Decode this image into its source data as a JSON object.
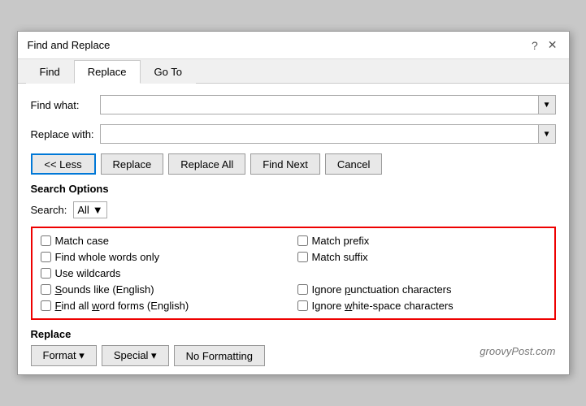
{
  "dialog": {
    "title": "Find and Replace",
    "help_icon": "?",
    "close_icon": "✕"
  },
  "tabs": [
    {
      "label": "Find",
      "active": false
    },
    {
      "label": "Replace",
      "active": true
    },
    {
      "label": "Go To",
      "active": false
    }
  ],
  "find_what": {
    "label": "Find what:",
    "value": "",
    "placeholder": ""
  },
  "replace_with": {
    "label": "Replace with:",
    "value": "",
    "placeholder": ""
  },
  "buttons": {
    "less": "<< Less",
    "replace": "Replace",
    "replace_all": "Replace All",
    "find_next": "Find Next",
    "cancel": "Cancel"
  },
  "search_options": {
    "title": "Search Options",
    "search_label": "Search:",
    "search_value": "All"
  },
  "checkboxes": [
    {
      "id": "match_case",
      "label": "Match case",
      "checked": false,
      "col": 1
    },
    {
      "id": "whole_words",
      "label": "Find whole words only",
      "checked": false,
      "col": 1
    },
    {
      "id": "wildcards",
      "label": "Use wildcards",
      "checked": false,
      "col": 1
    },
    {
      "id": "sounds_like",
      "label": "Sounds like (English)",
      "checked": false,
      "col": 1,
      "underline_char": "S"
    },
    {
      "id": "word_forms",
      "label": "Find all word forms (English)",
      "checked": false,
      "col": 1,
      "underline_char": "F"
    },
    {
      "id": "match_prefix",
      "label": "Match prefix",
      "checked": false,
      "col": 2
    },
    {
      "id": "match_suffix",
      "label": "Match suffix",
      "checked": false,
      "col": 2
    },
    {
      "id": "ignore_punct",
      "label": "Ignore punctuation characters",
      "checked": false,
      "col": 2,
      "underline_char": "p"
    },
    {
      "id": "ignore_space",
      "label": "Ignore white-space characters",
      "checked": false,
      "col": 2,
      "underline_char": "w"
    }
  ],
  "replace_section": {
    "title": "Replace",
    "format_label": "Format ▾",
    "special_label": "Special ▾",
    "no_formatting_label": "No Formatting"
  },
  "watermark": "groovyPost.com"
}
